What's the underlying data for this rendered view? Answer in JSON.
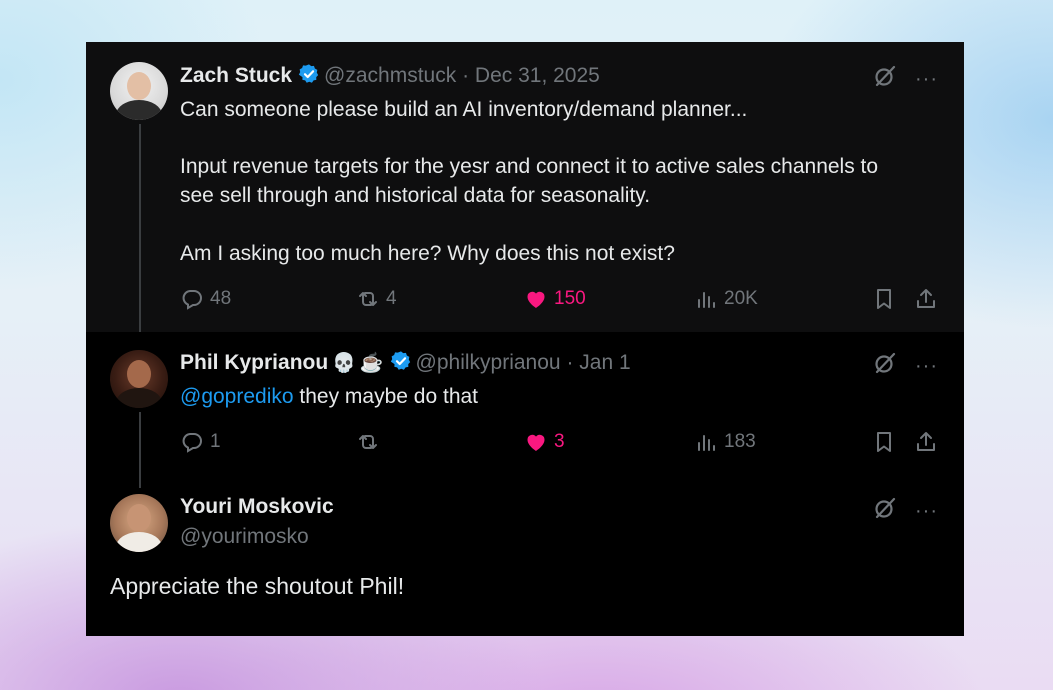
{
  "thread": {
    "main": {
      "name": "Zach Stuck",
      "handle": "@zachmstuck",
      "sep": "·",
      "date": "Dec 31, 2025",
      "lines": [
        "Can someone please build an AI inventory/demand planner...",
        "Input revenue targets for the yesr and connect it to active sales channels to",
        "see sell through and historical data for seasonality.",
        "Am I asking too much here? Why does this not exist?"
      ],
      "replies": "48",
      "reposts": "4",
      "likes": "150",
      "views": "20K"
    },
    "reply": {
      "name": "Phil Kyprianou",
      "emoji1": "💀",
      "emoji2": "☕",
      "handle": "@philkyprianou",
      "sep": "·",
      "date": "Jan 1",
      "mention": "@goprediko",
      "text": " they maybe do that",
      "replies": "1",
      "reposts": "",
      "likes": "3",
      "views": "183"
    },
    "quote": {
      "name": "Youri Moskovic",
      "handle": "@yourimosko",
      "text": "Appreciate the shoutout Phil!"
    }
  },
  "colors": {
    "background_card": "#000000",
    "main_post_bg": "#0e0e0f",
    "text": "#e7e9ea",
    "muted": "#71767b",
    "verified": "#1d9bf0",
    "like": "#f91880",
    "mention": "#1d9bf0"
  },
  "icons": [
    "verified-badge-icon",
    "grok-slash-icon",
    "more-icon",
    "reply-icon",
    "repost-icon",
    "heart-icon",
    "views-icon",
    "bookmark-icon",
    "share-icon"
  ]
}
